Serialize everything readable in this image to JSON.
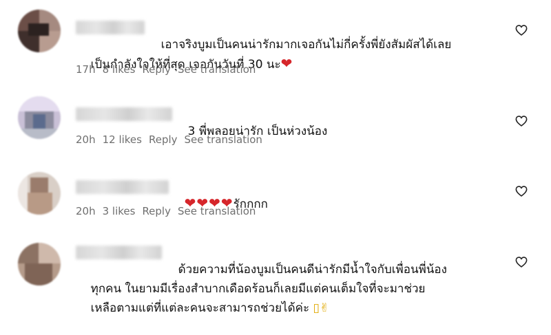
{
  "comments": [
    {
      "text_line1": "เอาจริงบูมเป็นคนน่ารักมากเจอกันไม่กี่ครั้งพี่ยังสัมผัสได้เลย",
      "text_line2": "เป็นกำลังใจให้ที่สุด เจอกันวันที่ 30 นะ",
      "emoji_end": "❤",
      "time": "17h",
      "likes": "8 likes",
      "reply": "Reply",
      "translate": "See translation"
    },
    {
      "text_line1": "3 พี่พลอยน่ารัก เป็นห่วงน้อง",
      "time": "20h",
      "likes": "12 likes",
      "reply": "Reply",
      "translate": "See translation"
    },
    {
      "hearts": "❤❤❤❤",
      "text_line1": "รักกกก",
      "time": "20h",
      "likes": "3 likes",
      "reply": "Reply",
      "translate": "See translation"
    },
    {
      "text_line1": "ด้วยความที่น้องบูมเป็นคนดีน่ารักมีน้ำใจกับเพื่อนพี่น้อง",
      "text_line2": "ทุกคน ในยามมีเรื่องสำบากเดือดร้อนก็เลยมีแต่คนเต็มใจที่จะมาช่วย",
      "text_line3": "เหลือตามแต่ที่แต่ละคนจะสามารถช่วยได้ค่ะ",
      "emoji_end": "▯✌"
    }
  ],
  "icons": {
    "like": "heart-outline-icon",
    "inline_heart": "red-heart-emoji"
  },
  "colors": {
    "text": "#111111",
    "meta": "#6f6f6f",
    "heart_red": "#d6262b",
    "background": "#ffffff"
  }
}
